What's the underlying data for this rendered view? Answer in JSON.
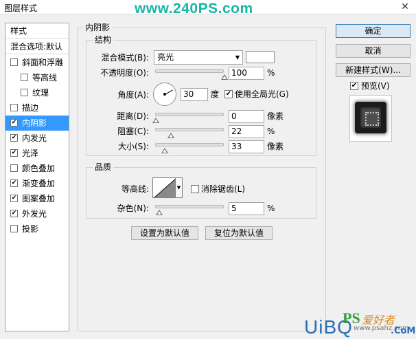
{
  "window": {
    "title": "图层样式",
    "watermark": "www.240PS.com",
    "close_glyph": "✕"
  },
  "style_list": {
    "header": "样式",
    "blend_options": "混合选项:默认",
    "items": [
      {
        "label": "斜面和浮雕",
        "checked": false,
        "indent": false,
        "selected": false
      },
      {
        "label": "等高线",
        "checked": false,
        "indent": true,
        "selected": false
      },
      {
        "label": "纹理",
        "checked": false,
        "indent": true,
        "selected": false
      },
      {
        "label": "描边",
        "checked": false,
        "indent": false,
        "selected": false
      },
      {
        "label": "内阴影",
        "checked": true,
        "indent": false,
        "selected": true
      },
      {
        "label": "内发光",
        "checked": true,
        "indent": false,
        "selected": false
      },
      {
        "label": "光泽",
        "checked": true,
        "indent": false,
        "selected": false
      },
      {
        "label": "颜色叠加",
        "checked": false,
        "indent": false,
        "selected": false
      },
      {
        "label": "渐变叠加",
        "checked": true,
        "indent": false,
        "selected": false
      },
      {
        "label": "图案叠加",
        "checked": true,
        "indent": false,
        "selected": false
      },
      {
        "label": "外发光",
        "checked": true,
        "indent": false,
        "selected": false
      },
      {
        "label": "投影",
        "checked": false,
        "indent": false,
        "selected": false
      }
    ]
  },
  "panel": {
    "title": "内阴影",
    "structure": {
      "title": "结构",
      "blend_mode_label": "混合模式(B):",
      "blend_mode_value": "亮光",
      "blend_color": "#ffffff",
      "opacity_label": "不透明度(O):",
      "opacity_value": "100",
      "opacity_unit": "%",
      "opacity_level": 1.0,
      "angle_label": "角度(A):",
      "angle_value": "30",
      "angle_unit": "度",
      "global_light_label": "使用全局光(G)",
      "global_light_checked": true,
      "distance_label": "距离(D):",
      "distance_value": "0",
      "distance_unit": "像素",
      "distance_level": 0.0,
      "choke_label": "阻塞(C):",
      "choke_value": "22",
      "choke_unit": "%",
      "choke_level": 0.22,
      "size_label": "大小(S):",
      "size_value": "33",
      "size_unit": "像素",
      "size_level": 0.13
    },
    "quality": {
      "title": "品质",
      "contour_label": "等高线:",
      "antialias_label": "消除锯齿(L)",
      "antialias_checked": false,
      "noise_label": "杂色(N):",
      "noise_value": "5",
      "noise_unit": "%",
      "noise_level": 0.05
    },
    "set_default_label": "设置为默认值",
    "reset_default_label": "复位为默认值"
  },
  "buttons": {
    "ok": "确定",
    "cancel": "取消",
    "new_style": "新建样式(W)...",
    "preview_label": "预览(V)",
    "preview_checked": true
  },
  "logo": {
    "ps": "PS",
    "cn": "爱好者",
    "url": "www.psahz.com",
    "uibq": "UiBQ",
    "com": ".CoM"
  },
  "icons": {
    "check": "✔",
    "dropdown": "▼"
  }
}
